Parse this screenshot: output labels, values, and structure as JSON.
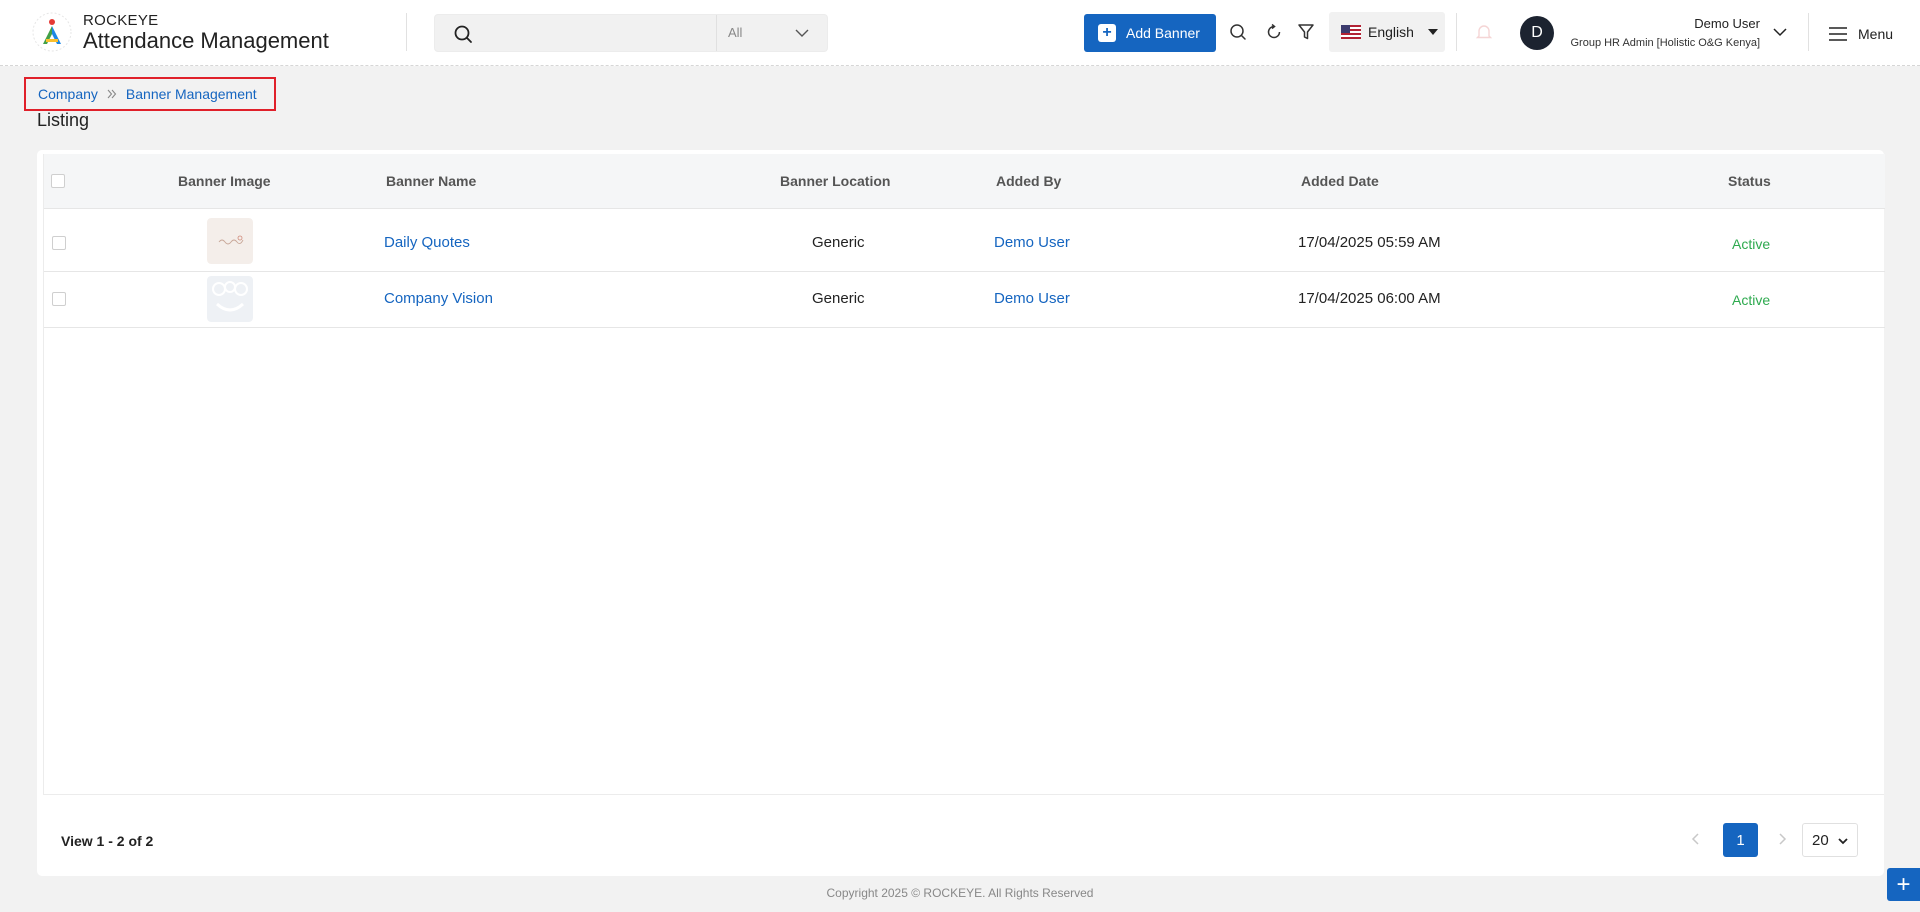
{
  "app": {
    "brand_top": "ROCKEYE",
    "brand_main": "Attendance Management"
  },
  "search": {
    "value": "",
    "placeholder": "",
    "filter_value": "All"
  },
  "toolbar": {
    "add_banner_label": "Add Banner",
    "language_label": "English",
    "menu_label": "Menu"
  },
  "user": {
    "initial": "D",
    "name": "Demo User",
    "role": "Group HR Admin [Holistic O&G Kenya]"
  },
  "breadcrumb": {
    "items": [
      "Company",
      "Banner Management"
    ]
  },
  "page": {
    "title": "Listing"
  },
  "table": {
    "headers": [
      "Banner Image",
      "Banner Name",
      "Banner Location",
      "Added By",
      "Added Date",
      "Status"
    ],
    "rows": [
      {
        "name": "Daily Quotes",
        "location": "Generic",
        "added_by": "Demo User",
        "added_date": "17/04/2025 05:59 AM",
        "status": "Active"
      },
      {
        "name": "Company Vision",
        "location": "Generic",
        "added_by": "Demo User",
        "added_date": "17/04/2025 06:00 AM",
        "status": "Active"
      }
    ]
  },
  "pagination": {
    "summary": "View 1 - 2 of 2",
    "current_page": "1",
    "page_size": "20"
  },
  "footer": {
    "copyright": "Copyright 2025 © ROCKEYE. All Rights Reserved"
  },
  "colors": {
    "primary": "#1565c0",
    "active_status": "#2eaa4f",
    "highlight_border": "#e0202a"
  }
}
